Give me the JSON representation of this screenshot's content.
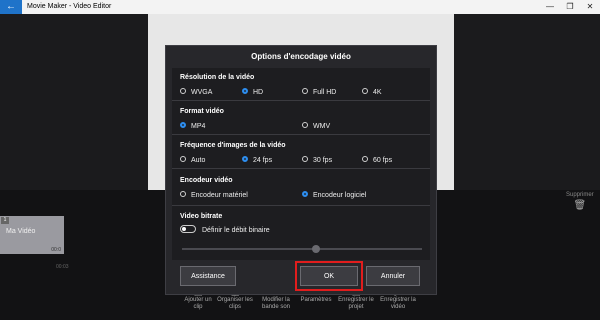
{
  "window": {
    "title": "Movie Maker - Video Editor",
    "back_icon": "back-arrow-icon",
    "minimize_glyph": "—",
    "maximize_glyph": "❐",
    "close_glyph": "✕"
  },
  "timeline": {
    "clip_number": "1",
    "clip_name": "Ma Vidéo",
    "clip_duration": "00:0",
    "clip_time": "00:03",
    "delete_label": "Supprimer",
    "delete_icon": "trash-icon"
  },
  "toolbar": [
    {
      "label": "Ajouter un clip",
      "icon": "add-clip-icon"
    },
    {
      "label": "Organiser les clips",
      "icon": "organize-icon"
    },
    {
      "label": "Modifier la bande son",
      "icon": "music-icon"
    },
    {
      "label": "Paramètres",
      "icon": "gear-icon"
    },
    {
      "label": "Enregistrer le projet",
      "icon": "save-icon"
    },
    {
      "label": "Enregistrer la vidéo",
      "icon": "export-video-icon"
    }
  ],
  "dialog": {
    "title": "Options d'encodage vidéo",
    "resolution": {
      "label": "Résolution de la vidéo",
      "options": [
        "WVGA",
        "HD",
        "Full HD",
        "4K"
      ],
      "selected": "HD"
    },
    "format": {
      "label": "Format vidéo",
      "options": [
        "MP4",
        "WMV"
      ],
      "selected": "MP4"
    },
    "framerate": {
      "label": "Fréquence d'images de la vidéo",
      "options": [
        "Auto",
        "24 fps",
        "30 fps",
        "60 fps"
      ],
      "selected": "24 fps"
    },
    "encoder": {
      "label": "Encodeur vidéo",
      "options": [
        "Encodeur matériel",
        "Encodeur logiciel"
      ],
      "selected": "Encodeur logiciel"
    },
    "bitrate": {
      "label": "Video bitrate",
      "toggle_label": "Définir le débit binaire",
      "toggle_on": false
    },
    "buttons": {
      "assist": "Assistance",
      "ok": "OK",
      "cancel": "Annuler"
    },
    "accent_color": "#2d8ef0",
    "highlight_color": "#e11d1d"
  }
}
